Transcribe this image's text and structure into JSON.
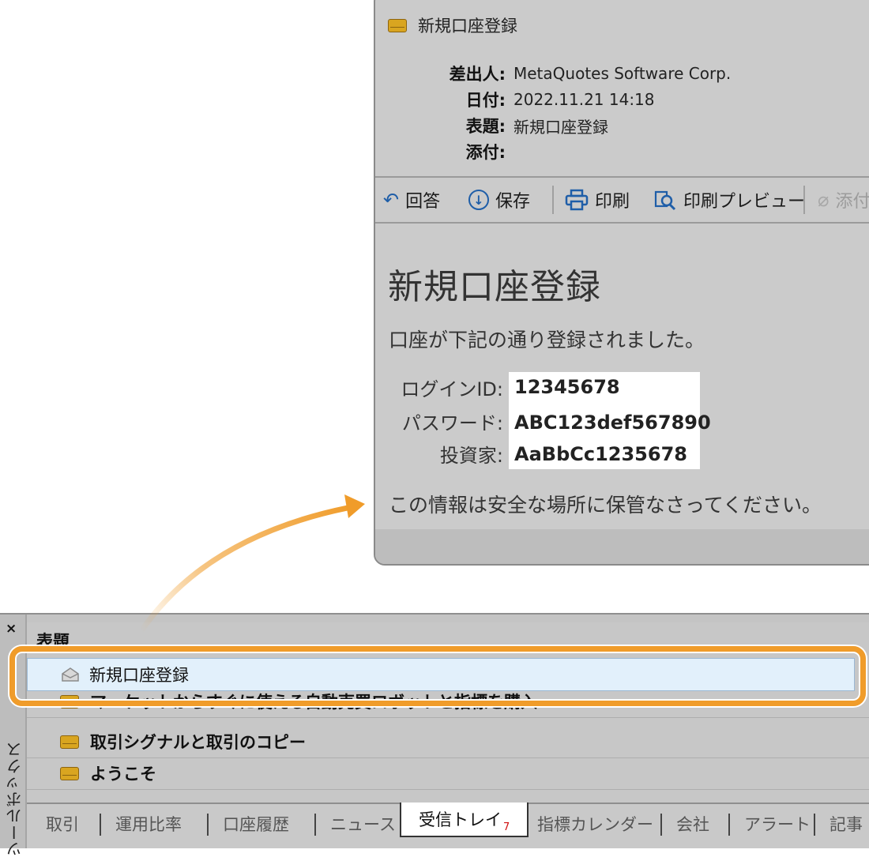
{
  "message": {
    "window_title": "新規口座登録",
    "header": {
      "sender_label": "差出人:",
      "sender": "MetaQuotes Software Corp.",
      "date_label": "日付:",
      "date": "2022.11.21 14:18",
      "subject_label": "表題:",
      "subject": "新規口座登録",
      "attach_label": "添付:"
    },
    "toolbar": {
      "reply": "回答",
      "save": "保存",
      "print": "印刷",
      "print_preview": "印刷プレビュー",
      "attach": "添付"
    },
    "body": {
      "title": "新規口座登録",
      "intro": "口座が下記の通り登録されました。",
      "login_label": "ログインID:",
      "login_value": "12345678",
      "password_label": "パスワード:",
      "password_value": "ABC123def567890",
      "investor_label": "投資家:",
      "investor_value": "AaBbCc1235678",
      "footer": "この情報は安全な場所に保管なさってください。"
    }
  },
  "toolbox": {
    "close": "×",
    "side_label": "ツールボックス",
    "column_header": "表題",
    "rows": [
      {
        "subject": "新規口座登録",
        "read": true
      },
      {
        "subject": "マーケットからすぐに使える自動売買ロボットと指標を購入",
        "read": false
      },
      {
        "subject": "取引シグナルと取引のコピー",
        "read": false
      },
      {
        "subject": "ようこそ",
        "read": false
      }
    ],
    "tabs": [
      "取引",
      "運用比率",
      "口座履歴",
      "ニュース",
      "受信トレイ",
      "指標カレンダー",
      "会社",
      "アラート",
      "記事"
    ],
    "active_tab": "受信トレイ",
    "inbox_badge": "7"
  },
  "colors": {
    "highlight_frame": "#f09c2a",
    "envelope": "#d9a520",
    "icon_blue": "#1f5ea8"
  }
}
